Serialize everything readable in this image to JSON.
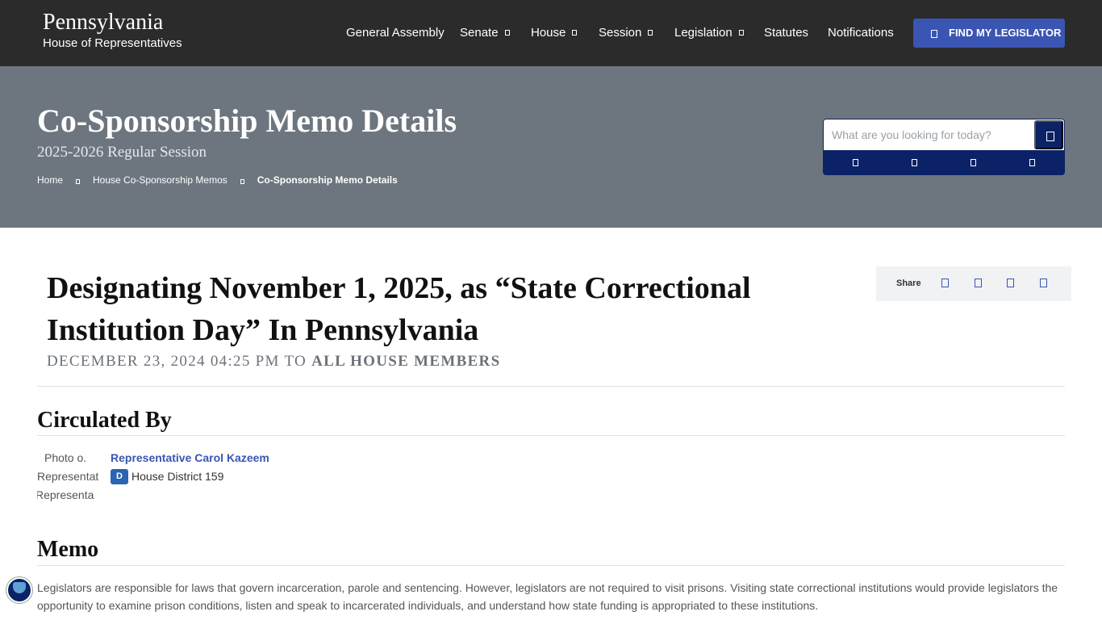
{
  "header": {
    "brand_title": "Pennsylvania",
    "brand_subtitle": "House of Representatives",
    "nav": [
      {
        "label": "General Assembly",
        "dropdown": false
      },
      {
        "label": "Senate",
        "dropdown": true
      },
      {
        "label": "House",
        "dropdown": true
      },
      {
        "label": "Session",
        "dropdown": true
      },
      {
        "label": "Legislation",
        "dropdown": true
      },
      {
        "label": "Statutes",
        "dropdown": false
      },
      {
        "label": "Notifications",
        "dropdown": false
      }
    ],
    "find_legislator_label": "FIND MY LEGISLATOR"
  },
  "hero": {
    "title": "Co-Sponsorship Memo Details",
    "subtitle": "2025-2026 Regular Session",
    "breadcrumbs": [
      "Home",
      "House Co-Sponsorship Memos",
      "Co-Sponsorship Memo Details"
    ],
    "search": {
      "placeholder": "What are you looking for today?",
      "value": ""
    }
  },
  "memo": {
    "title": "Designating November 1, 2025, as “State Correctional Institution Day” In Pennsylvania",
    "date_time": "December 23, 2024 04:25 PM",
    "to_word": "to",
    "recipients": "All House Members"
  },
  "share": {
    "label": "Share"
  },
  "circulated_by": {
    "heading": "Circulated By",
    "photo_alt": [
      "Photo o.",
      "Representat",
      "Representa"
    ],
    "name": "Representative Carol Kazeem",
    "party": "D",
    "district": "House District 159"
  },
  "memo_section": {
    "heading": "Memo",
    "body": "Legislators are responsible for laws that govern incarceration, parole and sentencing. However, legislators are not required to visit prisons. Visiting state correctional institutions would provide legislators the opportunity to examine prison conditions, listen and speak to incarcerated individuals, and understand how state funding is appropriated to these institutions."
  },
  "colors": {
    "navbar": "#2b2b2b",
    "hero": "#6d767e",
    "accent": "#3b55b3",
    "navy": "#0b2266",
    "party_badge": "#2a64b2"
  }
}
